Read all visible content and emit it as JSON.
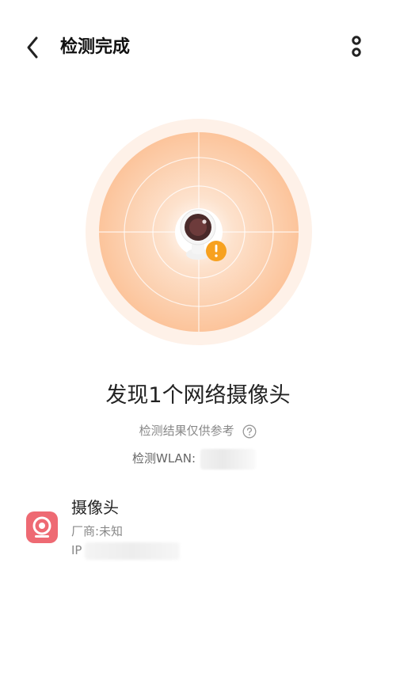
{
  "header": {
    "title": "检测完成",
    "back_icon": "chevron-left-icon",
    "more_icon": "more-vertical-icon"
  },
  "result": {
    "heading": "发现1个网络摄像头",
    "note": "检测结果仅供参考",
    "wlan_label": "检测WLAN:"
  },
  "device": {
    "name": "摄像头",
    "vendor": "厂商:未知",
    "ip_label": "IP"
  },
  "colors": {
    "accent_orange": "#f7a11f",
    "radar_fill": "#fcc9a1",
    "device_icon_bg": "#ee6a73"
  }
}
